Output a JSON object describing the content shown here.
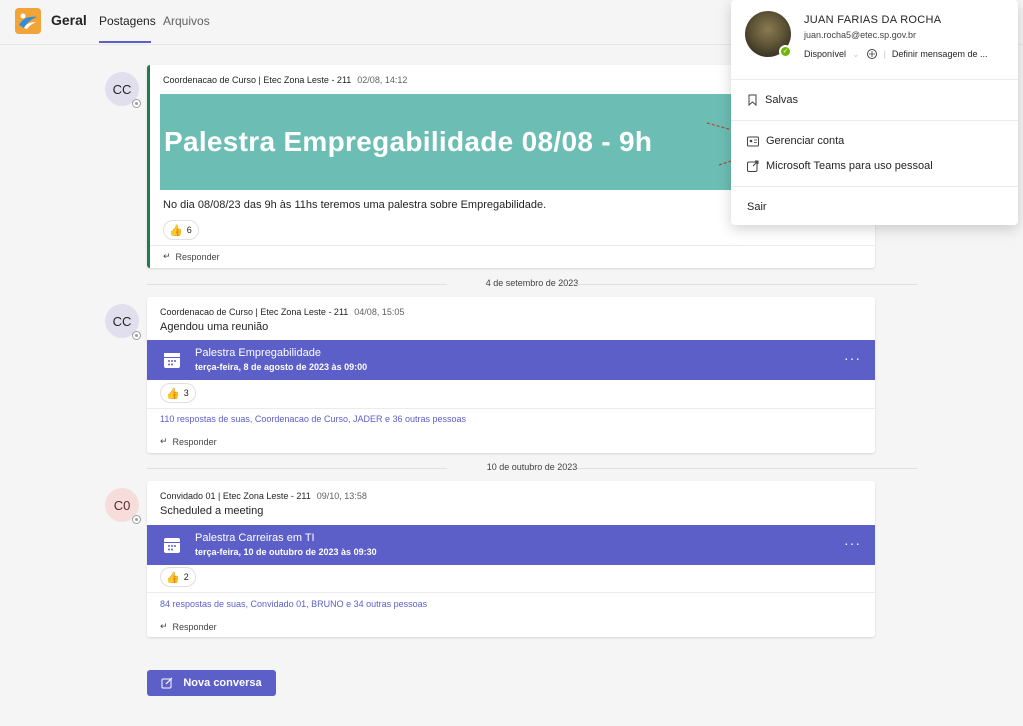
{
  "header": {
    "channel": "Geral",
    "tabs": [
      "Postagens",
      "Arquivos"
    ]
  },
  "posts": [
    {
      "avatar": "CC",
      "author": "Coordenacao de Curso | Etec Zona Leste - 211",
      "time": "02/08, 14:12",
      "banner_title": "Palestra Empregabilidade 08/08 - 9h",
      "text": "No dia 08/08/23 das 9h às 11hs teremos uma palestra sobre Empregabilidade.",
      "reaction": "6",
      "reply": "Responder"
    },
    {
      "avatar": "CC",
      "author": "Coordenacao de Curso | Etec Zona Leste - 211",
      "time": "04/08, 15:05",
      "text": "Agendou uma reunião",
      "meeting_title": "Palestra Empregabilidade",
      "meeting_date": "terça-feira, 8 de agosto de 2023 às 09:00",
      "reaction": "3",
      "replies": "110 respostas de suas, Coordenacao de Curso, JADER e 36 outras pessoas",
      "reply": "Responder"
    },
    {
      "avatar": "C0",
      "author": "Convidado 01 | Etec Zona Leste - 211",
      "time": "09/10, 13:58",
      "text": "Scheduled a meeting",
      "meeting_title": "Palestra Carreiras em TI",
      "meeting_date": "terça-feira, 10 de outubro de 2023 às 09:30",
      "reaction": "2",
      "replies": "84 respostas de suas, Convidado 01, BRUNO e 34 outras pessoas",
      "reply": "Responder"
    }
  ],
  "date_separators": [
    "4 de setembro de 2023",
    "10 de outubro de 2023"
  ],
  "new_conversation": "Nova conversa",
  "profile": {
    "name": "JUAN FARIAS DA ROCHA",
    "email": "juan.rocha5@etec.sp.gov.br",
    "status": "Disponível",
    "status_message": "Definir mensagem de ...",
    "menu": [
      "Salvas",
      "Gerenciar conta",
      "Microsoft Teams para uso pessoal",
      "Sair"
    ]
  },
  "colors": {
    "brand": "#5b5fc7",
    "banner": "#6cbeb4",
    "accent_border": "#237b4b",
    "available": "#6bb700"
  }
}
